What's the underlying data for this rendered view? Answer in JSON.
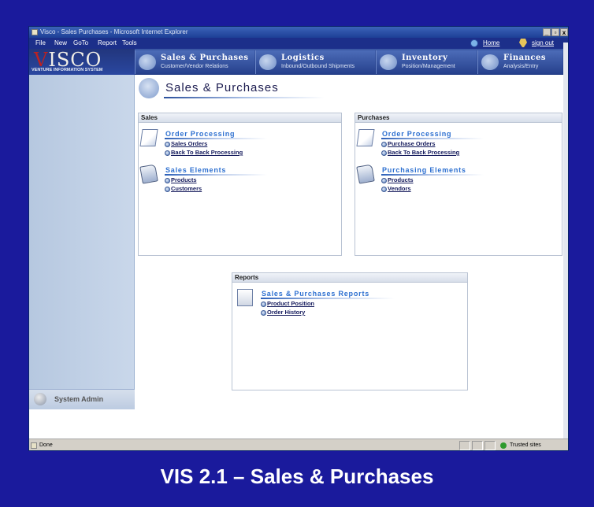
{
  "window": {
    "title": "Visco - Sales Purchases - Microsoft Internet Explorer",
    "controls": [
      "_",
      "▫",
      "x"
    ]
  },
  "menubar": {
    "items": [
      "File",
      "New",
      "GoTo",
      "Report",
      "Tools"
    ],
    "home_label": "Home",
    "signout_label": "sign out"
  },
  "logo": {
    "wordmark_v": "V",
    "wordmark_rest": "ISCO",
    "subtitle": "VENTURE INFORMATION SYSTEM"
  },
  "nav_tabs": [
    {
      "title": "Sales & Purchases",
      "subtitle": "Customer/Vendor Relations",
      "icon": "gears-icon"
    },
    {
      "title": "Logistics",
      "subtitle": "Inbound/Outbound Shipments",
      "icon": "globe-icon"
    },
    {
      "title": "Inventory",
      "subtitle": "Position/Management",
      "icon": "boxes-icon"
    },
    {
      "title": "Finances",
      "subtitle": "Analysis/Entry",
      "icon": "chart-icon"
    }
  ],
  "sidebar": {
    "system_admin": "System Admin"
  },
  "page": {
    "title": "Sales & Purchases"
  },
  "panels": {
    "sales": {
      "header": "Sales",
      "groups": [
        {
          "title": "Order Processing",
          "links": [
            "Sales Orders",
            "Back To Back Processing"
          ]
        },
        {
          "title": "Sales Elements",
          "links": [
            "Products",
            "Customers"
          ]
        }
      ]
    },
    "purchases": {
      "header": "Purchases",
      "groups": [
        {
          "title": "Order Processing",
          "links": [
            "Purchase Orders",
            "Back To Back Processing"
          ]
        },
        {
          "title": "Purchasing Elements",
          "links": [
            "Products",
            "Vendors"
          ]
        }
      ]
    },
    "reports": {
      "header": "Reports",
      "groups": [
        {
          "title": "Sales & Purchases Reports",
          "links": [
            "Product Position",
            "Order History"
          ]
        }
      ]
    }
  },
  "status": {
    "left": "Done",
    "right": "Trusted sites"
  },
  "caption": "VIS 2.1 – Sales & Purchases"
}
